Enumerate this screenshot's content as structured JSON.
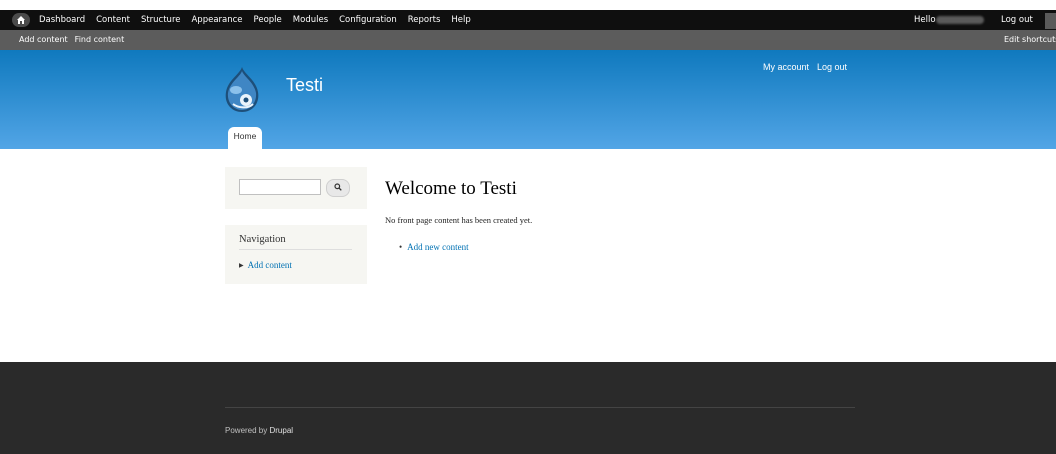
{
  "toolbar": {
    "menu": [
      "Dashboard",
      "Content",
      "Structure",
      "Appearance",
      "People",
      "Modules",
      "Configuration",
      "Reports",
      "Help"
    ],
    "hello": "Hello",
    "logout": "Log out"
  },
  "shortcuts": {
    "items": [
      "Add content",
      "Find content"
    ],
    "edit": "Edit shortcuts"
  },
  "header": {
    "site_name": "Testi",
    "secondary_menu": [
      "My account",
      "Log out"
    ],
    "tabs": [
      "Home"
    ]
  },
  "sidebar": {
    "nav_title": "Navigation",
    "nav_items": [
      "Add content"
    ]
  },
  "content": {
    "title": "Welcome to Testi",
    "message": "No front page content has been created yet.",
    "link": "Add new content"
  },
  "footer": {
    "powered": "Powered by",
    "drupal": "Drupal"
  },
  "colors": {
    "header_top": "#0f79be",
    "header_bottom": "#52a5e6",
    "link": "#0071b3",
    "footer": "#2a2a2a"
  }
}
